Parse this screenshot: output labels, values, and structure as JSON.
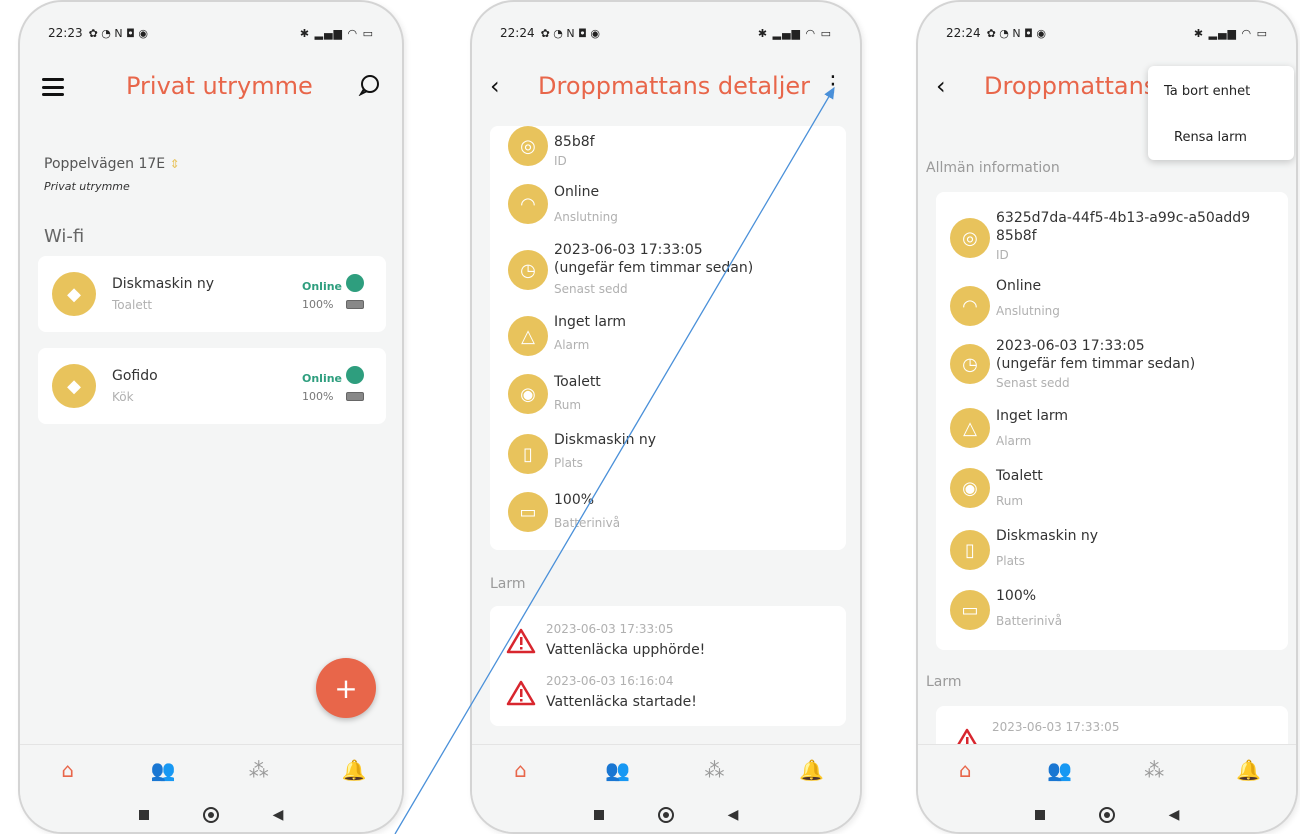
{
  "colors": {
    "accent": "#e8664a",
    "icon_circle": "#e8c35c",
    "online": "#2e9e7e"
  },
  "screen1": {
    "status_time": "22:23",
    "title": "Privat utrymme",
    "location": "Poppelvägen 17E",
    "location_sub": "Privat utrymme",
    "section": "Wi-fi",
    "devices": [
      {
        "name": "Diskmaskin ny",
        "room": "Toalett",
        "status": "Online",
        "battery": "100%"
      },
      {
        "name": "Gofido",
        "room": "Kök",
        "status": "Online",
        "battery": "100%"
      }
    ],
    "fab": "+"
  },
  "screen2": {
    "status_time": "22:24",
    "title": "Droppmattans detaljer",
    "rows": [
      {
        "value": "85b8f",
        "label": "ID",
        "icon": "target-icon"
      },
      {
        "value": "Online",
        "label": "Anslutning",
        "icon": "wifi-icon"
      },
      {
        "value": "2023-06-03 17:33:05",
        "value2": "(ungefär fem timmar sedan)",
        "label": "Senast sedd",
        "icon": "clock-icon"
      },
      {
        "value": "Inget larm",
        "label": "Alarm",
        "icon": "bell-icon"
      },
      {
        "value": "Toalett",
        "label": "Rum",
        "icon": "location-pin-icon"
      },
      {
        "value": "Diskmaskin ny",
        "label": "Plats",
        "icon": "appliance-icon"
      },
      {
        "value": "100%",
        "label": "Batterinivå",
        "icon": "battery-icon"
      }
    ],
    "alarm_section": "Larm",
    "alarms": [
      {
        "time": "2023-06-03 17:33:05",
        "text": "Vattenläcka upphörde!"
      },
      {
        "time": "2023-06-03 16:16:04",
        "text": "Vattenläcka startade!"
      }
    ]
  },
  "screen3": {
    "status_time": "22:24",
    "title": "Droppmattans",
    "menu": [
      "Ta bort enhet",
      "Rensa larm"
    ],
    "general_section": "Allmän information",
    "rows": [
      {
        "value": "6325d7da-44f5-4b13-a99c-a50add9",
        "value2": "85b8f",
        "label": "ID",
        "icon": "target-icon"
      },
      {
        "value": "Online",
        "label": "Anslutning",
        "icon": "wifi-icon"
      },
      {
        "value": "2023-06-03 17:33:05",
        "value2": "(ungefär fem timmar sedan)",
        "label": "Senast sedd",
        "icon": "clock-icon"
      },
      {
        "value": "Inget larm",
        "label": "Alarm",
        "icon": "bell-icon"
      },
      {
        "value": "Toalett",
        "label": "Rum",
        "icon": "location-pin-icon"
      },
      {
        "value": "Diskmaskin ny",
        "label": "Plats",
        "icon": "appliance-icon"
      },
      {
        "value": "100%",
        "label": "Batterinivå",
        "icon": "battery-icon"
      }
    ],
    "alarm_section": "Larm",
    "alarm_time": "2023-06-03 17:33:05"
  }
}
